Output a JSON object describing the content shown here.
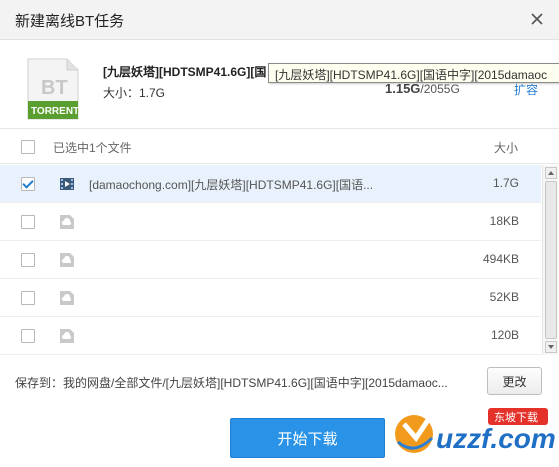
{
  "window": {
    "title": "新建离线BT任务"
  },
  "torrent": {
    "icon_top": "BT",
    "icon_bottom": "TORRENT",
    "name": "[九层妖塔][HDTSMP41.6G][国",
    "size_label": "大小：1.7G",
    "tooltip": "[九层妖塔][HDTSMP41.6G][国语中字][2015damaoc",
    "space_used": "1.15G",
    "space_total": "/2055G",
    "expand_link": "扩容"
  },
  "list_header": {
    "selected": "已选中1个文件",
    "size": "大小"
  },
  "files": [
    {
      "name": "[damaochong.com][九层妖塔][HDTSMP41.6G][国语...",
      "size": "1.7G",
      "checked": true,
      "type": "video-file-icon"
    },
    {
      "name": "",
      "size": "18KB",
      "checked": false,
      "type": "cloud-file-icon"
    },
    {
      "name": "",
      "size": "494KB",
      "checked": false,
      "type": "cloud-file-icon"
    },
    {
      "name": "",
      "size": "52KB",
      "checked": false,
      "type": "cloud-file-icon"
    },
    {
      "name": "",
      "size": "120B",
      "checked": false,
      "type": "cloud-file-icon"
    }
  ],
  "save": {
    "label": "保存到：我的网盘/全部文件/[九层妖塔][HDTSMP41.6G][国语中字][2015damaoc...",
    "change_button": "更改"
  },
  "start_button": "开始下载",
  "watermark": {
    "text": "uzzf.com",
    "badge": "东坡下载"
  },
  "colors": {
    "accent": "#2a93e8",
    "torrent_green": "#5a9e2f",
    "selected_row": "#e9f2fc"
  }
}
